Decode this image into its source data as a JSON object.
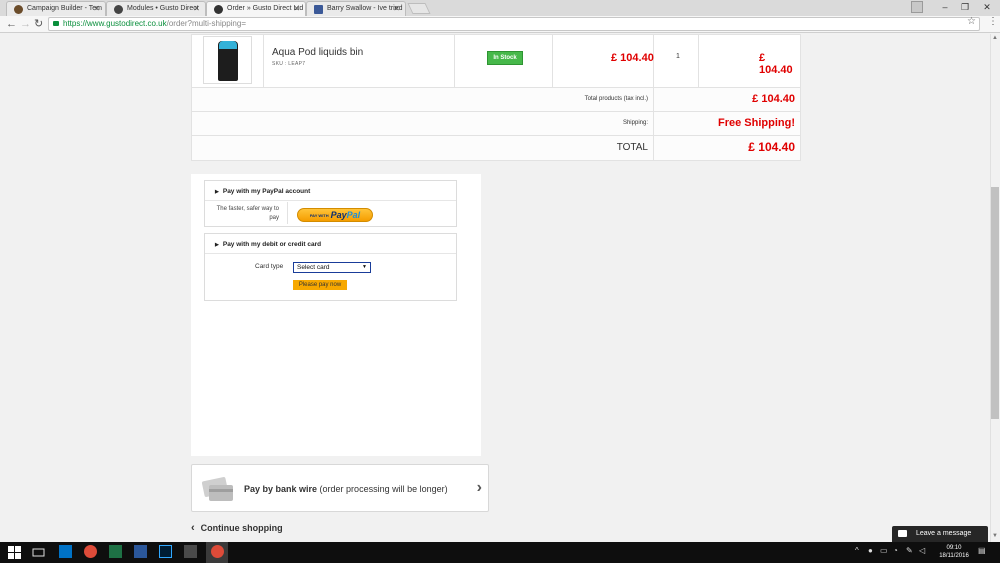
{
  "browser": {
    "tabs": [
      {
        "label": "Campaign Builder - Tem",
        "favicon_color": "#6b4c2a",
        "active": false
      },
      {
        "label": "Modules • Gusto Direct",
        "favicon_color": "#444444",
        "active": false
      },
      {
        "label": "Order » Gusto Direct Ltd",
        "favicon_color": "#333333",
        "active": true
      },
      {
        "label": "Barry Swallow - Ive tried",
        "favicon_color": "#3b5998",
        "active": false
      }
    ],
    "address": {
      "host": "https://www.gustodirect.co.uk",
      "path": "/order?multi-shipping="
    }
  },
  "cart": {
    "product": {
      "name": "Aqua Pod liquids bin",
      "sku": "SKU : LEAP7",
      "stock": "In Stock",
      "unit_price": "£ 104.40",
      "quantity": "1",
      "total": "£ 104.40"
    },
    "summary": [
      {
        "label": "Total products (tax incl.)",
        "value": "£ 104.40"
      },
      {
        "label": "Shipping:",
        "value": "Free Shipping!"
      },
      {
        "label": "TOTAL",
        "value": "£ 104.40"
      }
    ]
  },
  "payment": {
    "paypal": {
      "heading": "Pay with my PayPal account",
      "tagline": "The faster, safer way to pay",
      "button_small": "PAY WITH",
      "button_brand_a": "Pay",
      "button_brand_b": "Pal"
    },
    "card": {
      "heading": "Pay with my debit or credit card",
      "type_label": "Card type",
      "select_value": "Select card",
      "pay_button": "Please pay now"
    },
    "bankwire": {
      "bold": "Pay by bank wire",
      "rest": " (order processing will be longer)"
    },
    "continue": "Continue shopping"
  },
  "chat": {
    "label": "Leave a message"
  },
  "taskbar": {
    "time": "09:10",
    "date": "18/11/2016"
  },
  "colors": {
    "price_red": "#e00000",
    "stock_green": "#46b84a",
    "paynow_orange": "#f7a800"
  }
}
